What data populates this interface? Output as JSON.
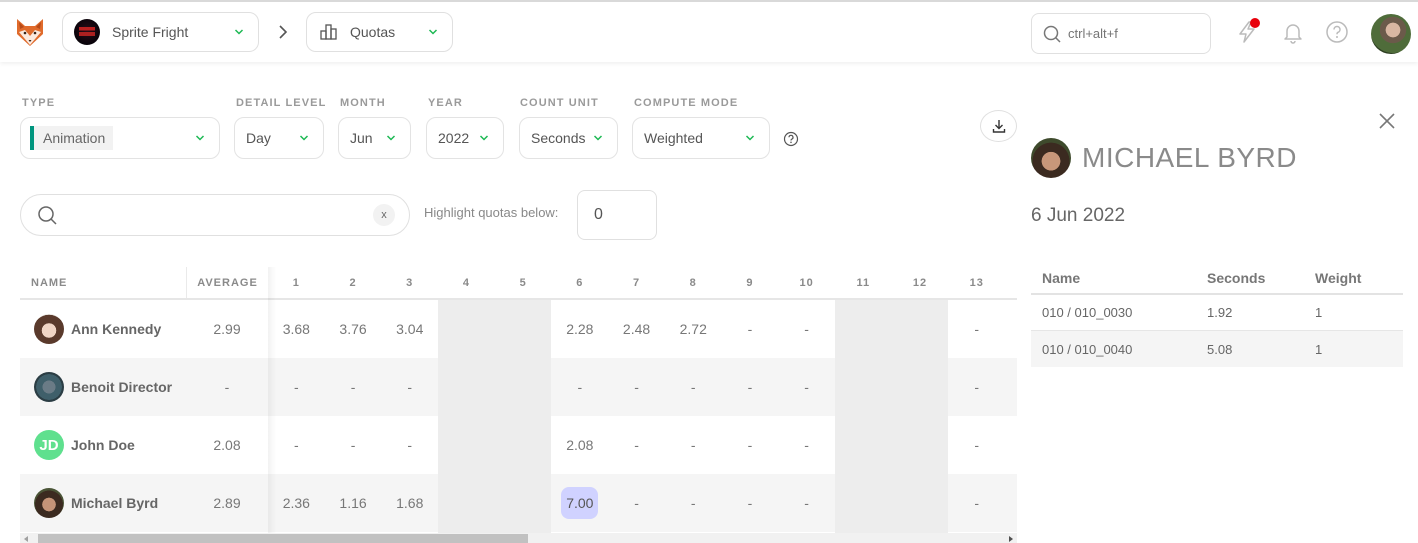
{
  "header": {
    "production": "Sprite Fright",
    "section": "Quotas",
    "search_placeholder": "ctrl+alt+f",
    "icons": [
      "kitsu-fox-logo",
      "production-thumbnail",
      "chevron-down-icon",
      "chevron-right-icon",
      "bar-chart-icon",
      "search-icon",
      "bolt-icon",
      "bell-icon",
      "help-icon",
      "user-avatar"
    ],
    "notification_dot_color": "#e8000b"
  },
  "filters": {
    "type": {
      "label": "TYPE",
      "value": "Animation",
      "color": "#00957e"
    },
    "detail_level": {
      "label": "DETAIL LEVEL",
      "value": "Day"
    },
    "month": {
      "label": "MONTH",
      "value": "Jun"
    },
    "year": {
      "label": "YEAR",
      "value": "2022"
    },
    "count_unit": {
      "label": "COUNT UNIT",
      "value": "Seconds"
    },
    "compute_mode": {
      "label": "COMPUTE MODE",
      "value": "Weighted"
    }
  },
  "search": {
    "value": "",
    "placeholder": "",
    "clear_label": "x"
  },
  "highlight": {
    "label": "Highlight quotas below:",
    "value": "0"
  },
  "table": {
    "headers": {
      "name": "NAME",
      "average": "AVERAGE"
    },
    "days": [
      "1",
      "2",
      "3",
      "4",
      "5",
      "6",
      "7",
      "8",
      "9",
      "10",
      "11",
      "12",
      "13"
    ],
    "weekend_days": [
      "4",
      "5",
      "11",
      "12"
    ],
    "rows": [
      {
        "name": "Ann Kennedy",
        "initials": "",
        "average": "2.99",
        "values": [
          "3.68",
          "3.76",
          "3.04",
          "-",
          "-",
          "2.28",
          "2.48",
          "2.72",
          "-",
          "-",
          "-",
          "-",
          "-"
        ]
      },
      {
        "name": "Benoit Director",
        "initials": "",
        "average": "-",
        "values": [
          "-",
          "-",
          "-",
          "-",
          "-",
          "-",
          "-",
          "-",
          "-",
          "-",
          "-",
          "-",
          "-"
        ]
      },
      {
        "name": "John Doe",
        "initials": "JD",
        "average": "2.08",
        "values": [
          "-",
          "-",
          "-",
          "-",
          "-",
          "2.08",
          "-",
          "-",
          "-",
          "-",
          "-",
          "-",
          "-"
        ]
      },
      {
        "name": "Michael Byrd",
        "initials": "",
        "average": "2.89",
        "values": [
          "2.36",
          "1.16",
          "1.68",
          "-",
          "-",
          "7.00",
          "-",
          "-",
          "-",
          "-",
          "-",
          "-",
          "-"
        ]
      }
    ],
    "selected_cell": {
      "row": 3,
      "day": "6",
      "color": "#d0d2ff"
    }
  },
  "panel": {
    "person": "MICHAEL BYRD",
    "date": "6 Jun 2022",
    "columns": [
      "Name",
      "Seconds",
      "Weight"
    ],
    "rows": [
      [
        "010 / 010_0030",
        "1.92",
        "1"
      ],
      [
        "010 / 010_0040",
        "5.08",
        "1"
      ]
    ]
  }
}
